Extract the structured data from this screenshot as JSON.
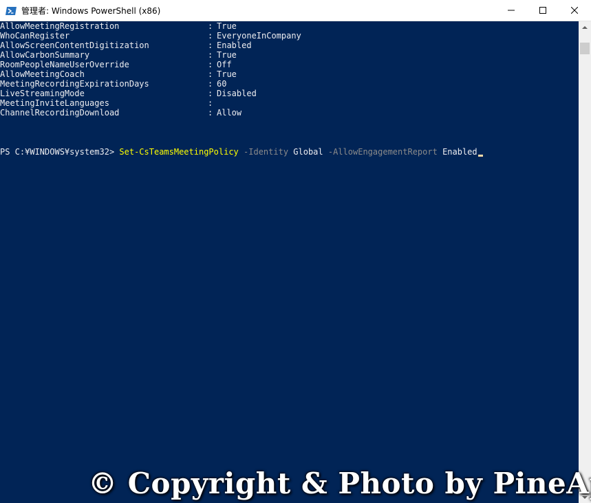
{
  "window": {
    "title": "管理者: Windows PowerShell (x86)",
    "minimize_icon": "minimize-icon",
    "maximize_icon": "maximize-icon",
    "close_icon": "close-icon"
  },
  "colors": {
    "console_background": "#012456",
    "console_text": "#eeedf0",
    "command_color": "#ffff00",
    "parameter_color": "#8a8a8a",
    "cursor_color": "#fedba9"
  },
  "output": {
    "separator": ":",
    "rows": [
      {
        "name": "AllowMeetingRegistration",
        "value": "True"
      },
      {
        "name": "WhoCanRegister",
        "value": "EveryoneInCompany"
      },
      {
        "name": "AllowScreenContentDigitization",
        "value": "Enabled"
      },
      {
        "name": "AllowCarbonSummary",
        "value": "True"
      },
      {
        "name": "RoomPeopleNameUserOverride",
        "value": "Off"
      },
      {
        "name": "AllowMeetingCoach",
        "value": "True"
      },
      {
        "name": "MeetingRecordingExpirationDays",
        "value": "60"
      },
      {
        "name": "LiveStreamingMode",
        "value": "Disabled"
      },
      {
        "name": "MeetingInviteLanguages",
        "value": ""
      },
      {
        "name": "ChannelRecordingDownload",
        "value": "Allow"
      }
    ]
  },
  "prompt": {
    "path": "PS C:¥WINDOWS¥system32> ",
    "command": "Set-CsTeamsMeetingPolicy",
    "param1": "-Identity",
    "arg1": "Global",
    "param2": "-AllowEngagementReport",
    "arg2": "Enabled"
  },
  "watermark": {
    "text": "© Copyright & Photo by PineApple"
  }
}
